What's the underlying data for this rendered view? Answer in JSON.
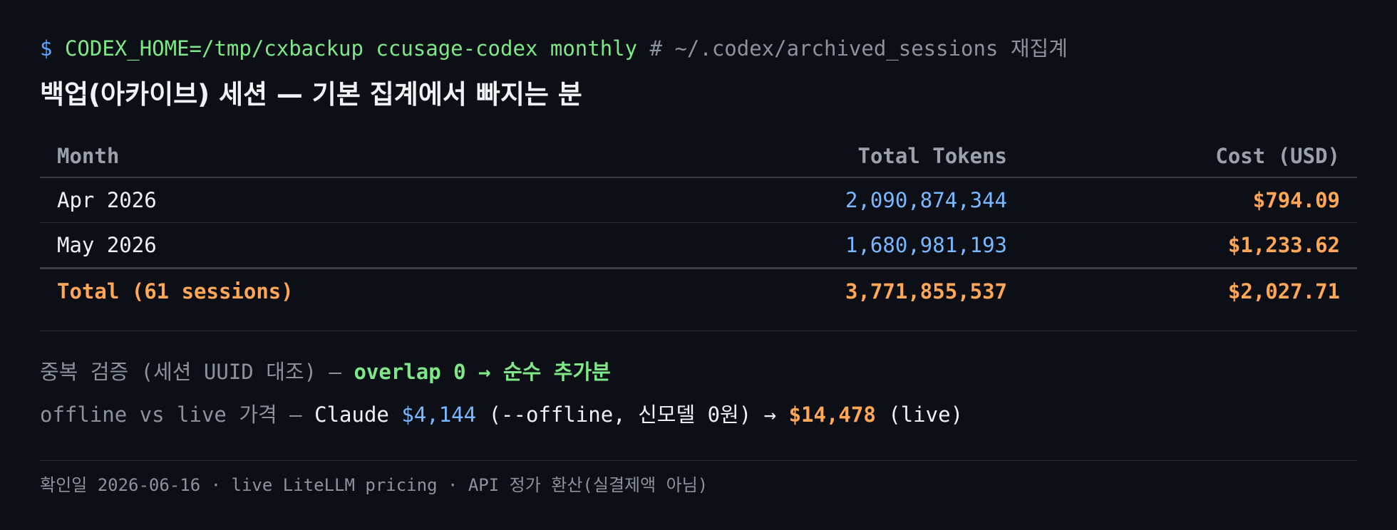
{
  "command": {
    "prompt": "$",
    "text": "CODEX_HOME=/tmp/cxbackup ccusage-codex monthly",
    "comment": "# ~/.codex/archived_sessions 재집계"
  },
  "title": "백업(아카이브) 세션 — 기본 집계에서 빠지는 분",
  "table": {
    "headers": {
      "month": "Month",
      "tokens": "Total Tokens",
      "cost": "Cost (USD)"
    },
    "rows": [
      {
        "month": "Apr 2026",
        "tokens": "2,090,874,344",
        "cost": "$794.09"
      },
      {
        "month": "May 2026",
        "tokens": "1,680,981,193",
        "cost": "$1,233.62"
      }
    ],
    "total": {
      "label": "Total (61 sessions)",
      "tokens": "3,771,855,537",
      "cost": "$2,027.71"
    }
  },
  "notes": {
    "dedupe": {
      "label": "중복 검증 (세션 UUID 대조) —",
      "result": "overlap 0 → 순수 추가분"
    },
    "pricing": {
      "label": "offline vs live 가격 —",
      "claude_label": "Claude",
      "offline_value": "$4,144",
      "offline_note": "(--offline, 신모델 0원) →",
      "live_value": "$14,478",
      "live_note": "(live)"
    }
  },
  "footer": "확인일 2026-06-16 · live LiteLLM pricing · API 정가 환산(실결제액 아님)",
  "colors": {
    "background": "#0c0f16",
    "prompt": "#58a6ff",
    "command": "#7ee787",
    "tokens": "#79b8ff",
    "cost": "#ffa657",
    "muted": "#8b929e"
  }
}
